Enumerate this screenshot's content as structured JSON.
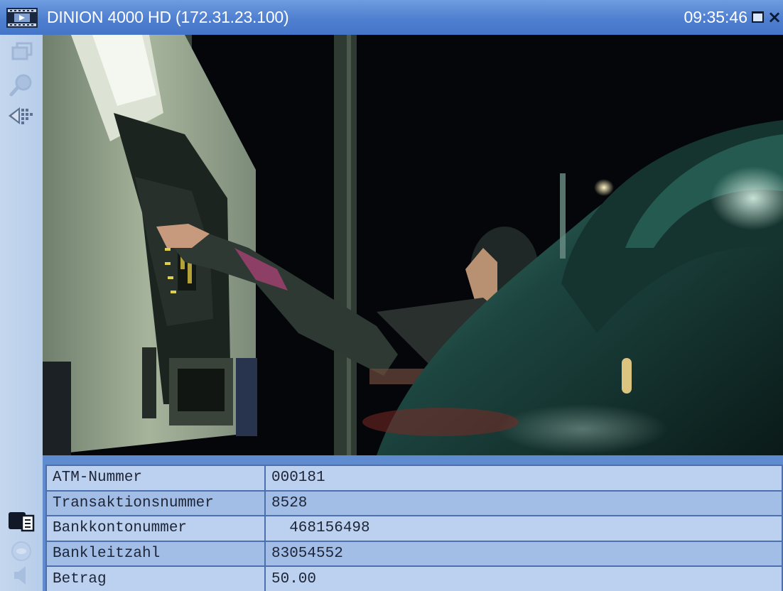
{
  "window": {
    "title": "DINION 4000 HD (172.31.23.100)",
    "time": "09:35:46",
    "close_glyph": "×",
    "maximize_icon": "maximize-icon",
    "app_icon": "video-film-icon"
  },
  "toolbar": {
    "items": [
      {
        "icon": "window-stack-icon",
        "enabled": false
      },
      {
        "icon": "zoom-search-icon",
        "enabled": false
      },
      {
        "icon": "ptz-diamond-icon",
        "enabled": true
      },
      {
        "icon": "text-data-overlay-icon",
        "enabled": true
      },
      {
        "icon": "record-icon",
        "enabled": false
      },
      {
        "icon": "audio-speaker-icon",
        "enabled": false
      }
    ]
  },
  "transaction_data": {
    "rows": [
      {
        "label": "ATM-Nummer",
        "value": "000181"
      },
      {
        "label": "Transaktionsnummer",
        "value": "8528"
      },
      {
        "label": "Bankkontonummer",
        "value": "  468156498"
      },
      {
        "label": "Bankleitzahl",
        "value": "83054552"
      },
      {
        "label": "Betrag",
        "value": "50.00"
      }
    ]
  },
  "colors": {
    "titlebar": "#4f7fd0",
    "table_odd": "#bcd1ef",
    "table_even": "#a2bde6"
  }
}
